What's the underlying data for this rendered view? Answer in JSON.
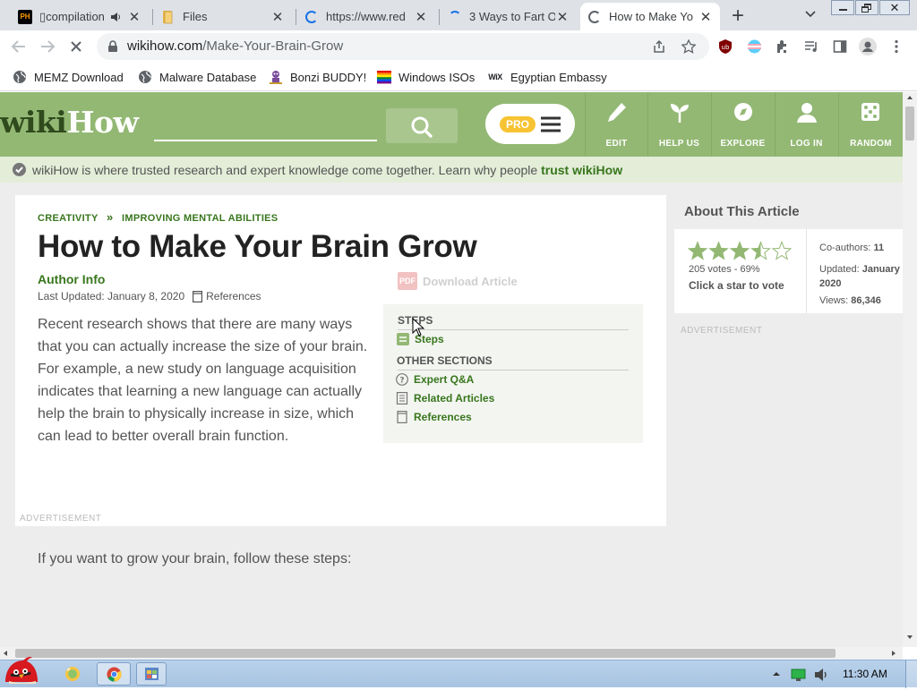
{
  "browser": {
    "tabs": [
      {
        "title": "▯compilation",
        "favicon": "pornhub-icon",
        "muted_icon": "speaker-icon",
        "close": "✕"
      },
      {
        "title": "Files",
        "favicon": "folder-icon",
        "close": "✕"
      },
      {
        "title": "https://www.red",
        "favicon": "loading-spinner",
        "close": "✕"
      },
      {
        "title": "3 Ways to Fart O",
        "favicon": "loading-spinner",
        "close": "✕"
      },
      {
        "title": "How to Make Yo",
        "favicon": "loading-spinner",
        "close": "✕",
        "active": true
      }
    ],
    "new_tab": "+",
    "url_host": "wikihow.com",
    "url_path": "/Make-Your-Brain-Grow",
    "bookmarks": [
      {
        "label": "MEMZ Download",
        "icon": "globe-icon"
      },
      {
        "label": "Malware Database",
        "icon": "globe-icon"
      },
      {
        "label": "Bonzi BUDDY!",
        "icon": "bonzi-icon"
      },
      {
        "label": "Windows ISOs",
        "icon": "windows-flag-icon"
      },
      {
        "label": "Egyptian Embassy",
        "icon": "wix-icon"
      }
    ]
  },
  "wikihow": {
    "logo_wiki": "wiki",
    "logo_how": "How",
    "pro_badge": "PRO",
    "nav": [
      {
        "label": "EDIT",
        "icon": "pencil-icon"
      },
      {
        "label": "HELP US",
        "icon": "sprout-icon"
      },
      {
        "label": "EXPLORE",
        "icon": "compass-icon"
      },
      {
        "label": "LOG IN",
        "icon": "user-icon"
      },
      {
        "label": "RANDOM",
        "icon": "dice-icon"
      }
    ],
    "trust_text": "wikiHow is where trusted research and expert knowledge come together. Learn why people ",
    "trust_link": "trust wikiHow",
    "breadcrumb_1": "CREATIVITY",
    "breadcrumb_sep": "»",
    "breadcrumb_2": "IMPROVING MENTAL ABILITIES",
    "title": "How to Make Your Brain Grow",
    "author_info": "Author Info",
    "last_updated": "Last Updated: January 8, 2020",
    "references": "References",
    "download": "Download Article",
    "intro": [
      "Recent research shows that there are many ways",
      "that you can actually increase the size of your brain.",
      "For example, a new study on language acquisition",
      "indicates that learning a new language can actually",
      "help the brain to physically increase in size, which",
      "can lead to better overall brain function."
    ],
    "intro_2": "If you want to grow your brain, follow these steps:",
    "advertisement": "ADVERTISEMENT",
    "toc": {
      "steps_heading": "STEPS",
      "steps_item": "Steps",
      "other_heading": "OTHER SECTIONS",
      "items": [
        "Expert Q&A",
        "Related Articles",
        "References"
      ]
    },
    "about": {
      "heading": "About This Article",
      "rating": 3.5,
      "max_rating": 5,
      "votes": "205 votes - 69%",
      "vote_prompt": "Click a star to vote",
      "coauthors_label": "Co-authors:",
      "coauthors_value": "11",
      "updated_label": "Updated:",
      "updated_value": "January 2020",
      "views_label": "Views:",
      "views_value": "86,346"
    },
    "sidebar_ad": "ADVERTISEMENT"
  },
  "taskbar": {
    "clock": "11:30 AM"
  },
  "colors": {
    "wikihow_green": "#93b874",
    "link_green": "#38761d",
    "trust_bar": "#e3edd8"
  }
}
